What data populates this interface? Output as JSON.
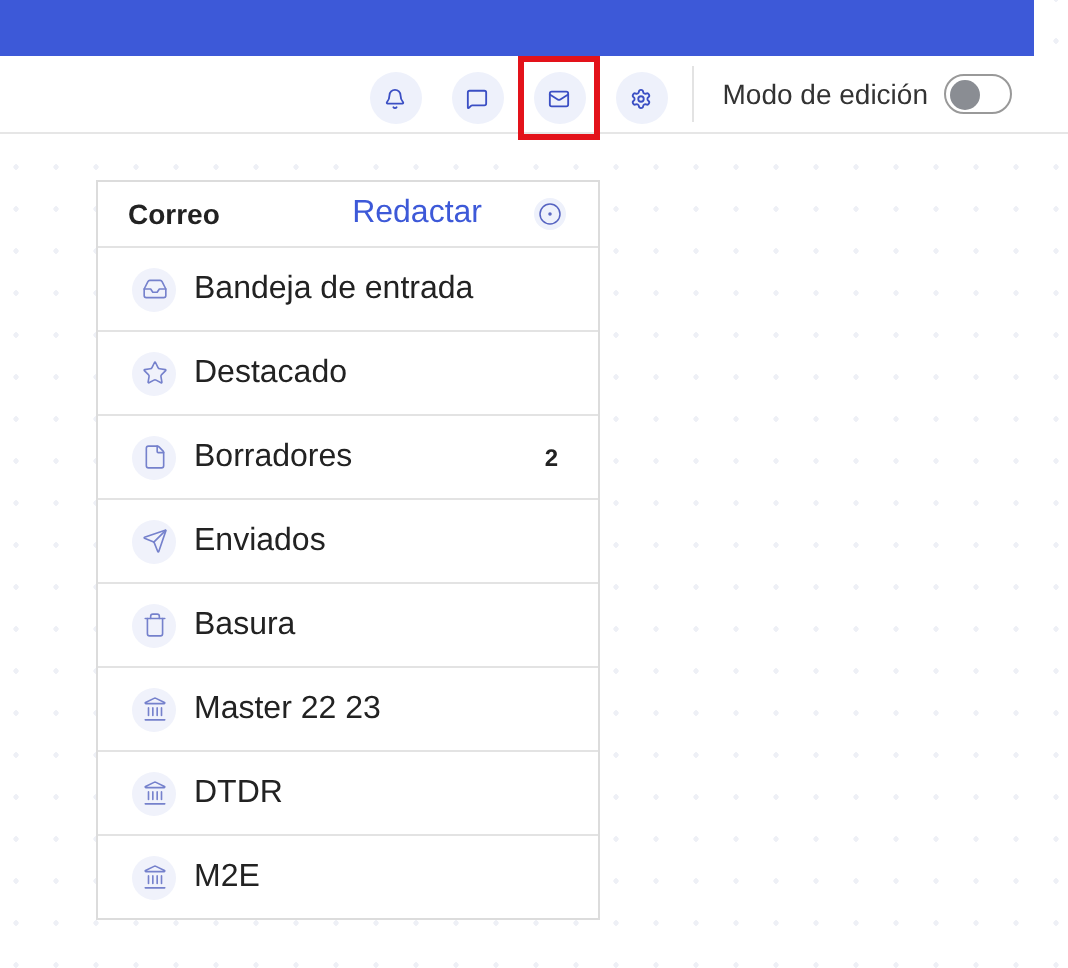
{
  "toolbar": {
    "icons": [
      {
        "kind": "bell",
        "selected": false
      },
      {
        "kind": "chat",
        "selected": false
      },
      {
        "kind": "mail",
        "selected": true
      },
      {
        "kind": "gear",
        "selected": false
      }
    ],
    "edit_mode": {
      "label": "Modo de edición",
      "on": false
    }
  },
  "mail_menu": {
    "title": "Correo",
    "compose": "Redactar",
    "folders": [
      {
        "kind": "inbox",
        "label": "Bandeja de entrada"
      },
      {
        "kind": "star",
        "label": "Destacado"
      },
      {
        "kind": "draft",
        "label": "Borradores",
        "count": "2"
      },
      {
        "kind": "sent",
        "label": "Enviados"
      },
      {
        "kind": "trash",
        "label": "Basura"
      },
      {
        "kind": "account",
        "label": "Master 22 23"
      },
      {
        "kind": "account",
        "label": "DTDR"
      },
      {
        "kind": "account",
        "label": "M2E"
      }
    ]
  }
}
